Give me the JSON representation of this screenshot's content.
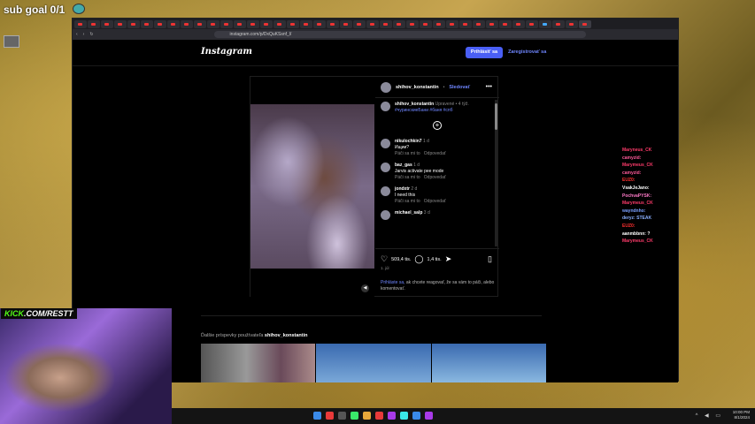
{
  "overlay": {
    "sub_goal": "sub goal 0/1",
    "kick_prefix": "KICK",
    "kick_suffix": ".COM/RESTT"
  },
  "browser": {
    "url": "instagram.com/p/DxQuKSsnf_l/"
  },
  "header": {
    "logo": "Instagram",
    "login": "Prihlásiť sa",
    "signup": "Zaregistrovať sa"
  },
  "post": {
    "username": "shihov_konstantin",
    "follow": "Sledovať",
    "caption_user": "shihov_konstantin",
    "caption_meta": "Upravené • 4 týž.",
    "caption_tags": "#чуринскиеБани #баня #спб",
    "comments": [
      {
        "user": "nikulochkin7",
        "time": "1 d",
        "text": "Ищии?",
        "like": "Páči sa mi to",
        "reply": "Odpovedať"
      },
      {
        "user": "baz_gas",
        "time": "1 d",
        "text": "Jarvis activate pee mode",
        "like": "Páči sa mi to",
        "reply": "Odpovedať"
      },
      {
        "user": "jondxtr",
        "time": "2 d",
        "text": "I need this",
        "like": "Páči sa mi to",
        "reply": "Odpovedať"
      },
      {
        "user": "michael_salp",
        "time": "3 d",
        "text": "",
        "like": "",
        "reply": ""
      }
    ],
    "likes": "509,4 tis.",
    "comment_count": "1,4 tis.",
    "date": "1. júl",
    "login_link": "Prihláste sa,",
    "login_text": " ak chcete reagovať, že sa vám to páči, alebo komentovať."
  },
  "more_posts": {
    "prefix": "Ďalšie príspevky používateľa ",
    "user": "shihov_konstantin"
  },
  "chat": [
    {
      "user": "Maryneus_CK",
      "color": "#ff3b6b"
    },
    {
      "user": "camyzid:",
      "color": "#ff5a9a"
    },
    {
      "user": "Marymeus_CK",
      "color": "#ff3b6b"
    },
    {
      "user": "camyzid:",
      "color": "#ff5a9a"
    },
    {
      "user": "EUZ0:",
      "color": "#ff3030"
    },
    {
      "user": "VsakJeJano:",
      "color": "#ffffff"
    },
    {
      "user": "PochvaPYSK:",
      "color": "#ff7ac8"
    },
    {
      "user": "Marymeus_CK",
      "color": "#ff3b6b"
    },
    {
      "user": "wayndnho:",
      "color": "#7aa0ff"
    },
    {
      "user": "deryz: STEAK",
      "color": "#8ab0ff"
    },
    {
      "user": "EUZ0:",
      "color": "#ff3030"
    },
    {
      "user": "aanmbbnn: ?",
      "color": "#ffffff"
    },
    {
      "user": "Marymeus_CK",
      "color": "#ff3b6b"
    }
  ],
  "clock": {
    "time": "10:00 PM",
    "date": "8/1/2024"
  }
}
